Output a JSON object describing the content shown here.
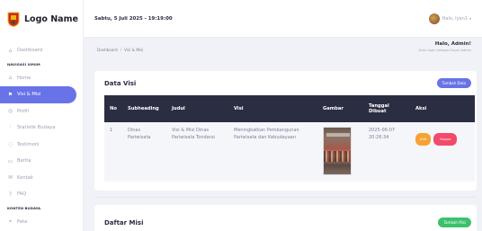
{
  "logo": {
    "name": "Logo Name"
  },
  "topbar": {
    "datetime": "Sabtu, 5 Juli 2025 - 19:19:00",
    "user_greeting": "Halo, Iyan1"
  },
  "sidebar": {
    "dashboard": "Dashboard",
    "section_navigasi": "NAVIGASI UMUM",
    "items": [
      {
        "label": "Home",
        "icon": "home-icon"
      },
      {
        "label": "Visi & Misi",
        "icon": "flag-icon",
        "active": true
      },
      {
        "label": "Profil",
        "icon": "profile-icon"
      },
      {
        "label": "Statistik Budaya",
        "icon": "chart-icon"
      },
      {
        "label": "Testimoni",
        "icon": "chat-icon"
      },
      {
        "label": "Berita",
        "icon": "news-icon"
      },
      {
        "label": "Kontak",
        "icon": "mail-icon"
      },
      {
        "label": "FAQ",
        "icon": "help-icon"
      }
    ],
    "section_konten": "KONTEN BUDAYA",
    "peta": "Peta"
  },
  "breadcrumb": {
    "root": "Dashboard",
    "current": "Visi & Misi"
  },
  "greeting": {
    "title": "Halo, Admin!",
    "subtitle": "Anda login sebagai Super Admin"
  },
  "visi": {
    "title": "Data Visi",
    "add_label": "Tambah Data",
    "columns": [
      "No",
      "Subheading",
      "Judul",
      "Visi",
      "Gambar",
      "Tanggal Dibuat",
      "Aksi"
    ],
    "rows": [
      {
        "no": "1",
        "subheading": "Dinas Pariwisata",
        "judul": "Visi & Misi Dinas Pariwisata Tondano",
        "visi": "Meningkatkan Pembangunan Pariwisata dan Kebudayaan",
        "tanggal": "2025-06-07 20:26:34",
        "edit_label": "Edit",
        "delete_label": "Hapus"
      }
    ]
  },
  "misi": {
    "title": "Daftar Misi",
    "add_label": "Tambah Misi"
  },
  "colors": {
    "accent": "#6873e8",
    "header": "#2b2d42",
    "edit": "#f6a234",
    "delete": "#f24a6a",
    "add_misi": "#3bc16c"
  }
}
